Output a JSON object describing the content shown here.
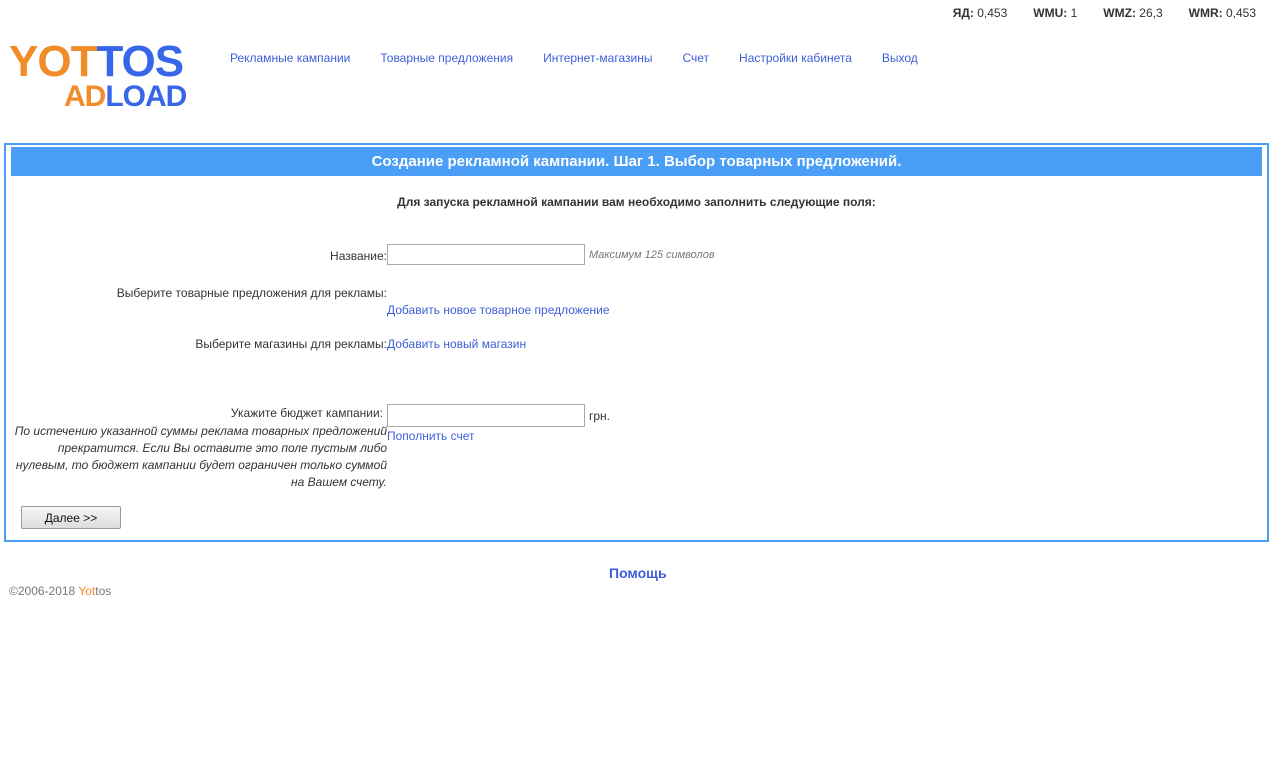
{
  "balances": [
    {
      "label": "ЯД:",
      "value": "0,453"
    },
    {
      "label": "WMU:",
      "value": "1"
    },
    {
      "label": "WMZ:",
      "value": "26,3"
    },
    {
      "label": "WMR:",
      "value": "0,453"
    }
  ],
  "logo": {
    "line1_a": "YOT",
    "line1_b": "TOS",
    "line2_a": "AD",
    "line2_b": "LOAD"
  },
  "nav": [
    "Рекламные кампании",
    "Товарные предложения",
    "Интернет-магазины",
    "Счет",
    "Настройки кабинета",
    "Выход"
  ],
  "panel": {
    "title": "Создание рекламной кампании. Шаг 1. Выбор товарных предложений.",
    "intro": "Для запуска рекламной кампании вам необходимо заполнить следующие поля:",
    "name_label": "Название:",
    "name_value": "",
    "name_hint": "Максимум 125 символов",
    "offers_label": "Выберите товарные предложения для рекламы:",
    "offers_link": "Добавить новое товарное предложение",
    "shops_label": "Выберите магазины для рекламы:",
    "shops_link": "Добавить новый магазин",
    "budget_label": "Укажите бюджет кампании:",
    "budget_value": "",
    "budget_currency": "грн.",
    "budget_link": "Пополнить счет",
    "budget_note": "По истечению указанной суммы реклама товарных предложений прекратится. Если Вы оставите это поле пустым либо нулевым, то бюджет кампании будет ограничен только суммой на Вашем счету.",
    "next_button": "Далее >>"
  },
  "help": "Помощь",
  "footer": {
    "copyright": "©2006-2018 ",
    "brand_a": "Yot",
    "brand_b": "tos"
  },
  "colors": {
    "accent": "#4a9ef5",
    "link": "#3d5fd9",
    "logo_orange": "#f28c28",
    "logo_blue": "#3866e8"
  }
}
